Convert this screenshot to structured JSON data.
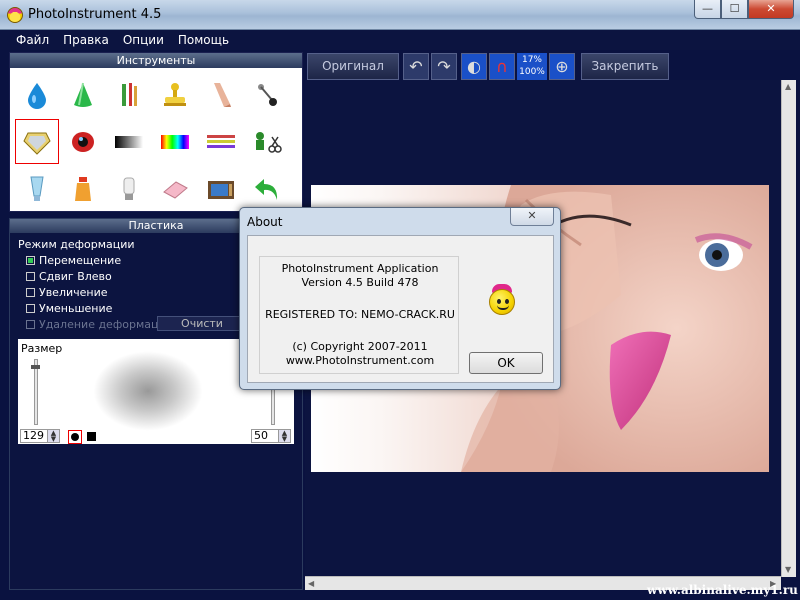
{
  "window": {
    "title": "PhotoInstrument 4.5",
    "min": "—",
    "max": "☐",
    "close": "✕"
  },
  "menu": [
    "Файл",
    "Правка",
    "Опции",
    "Помощь"
  ],
  "tools_panel": {
    "title": "Инструменты",
    "tools": [
      "drop-tool-icon",
      "cone-tool-icon",
      "pencil-brush-icon",
      "stamp-icon",
      "smudge-icon",
      "pin-icon",
      "diamond-icon",
      "red-eye-icon",
      "gradient-icon",
      "rainbow-palette-icon",
      "color-lines-icon",
      "cut-paste-icon",
      "tube-icon",
      "bottle-icon",
      "bulb-icon",
      "eraser-icon",
      "tv-icon",
      "undo-arrow-icon"
    ]
  },
  "plastic_panel": {
    "title": "Пластика",
    "mode_label": "Режим деформации",
    "options": [
      {
        "label": "Перемещение",
        "checked": true
      },
      {
        "label": "Сдвиг Влево",
        "checked": false
      },
      {
        "label": "Увеличение",
        "checked": false
      },
      {
        "label": "Уменьшение",
        "checked": false
      }
    ],
    "remove_label": "Удаление деформации",
    "clear_label": "Очисти",
    "size_label": "Размер",
    "close_mark": "X",
    "left_value": "129",
    "right_value": "50"
  },
  "toolbar": {
    "original_label": "Оригинал",
    "zoom_top": "17%",
    "zoom_bottom": "100%",
    "pin_label": "Закрепить"
  },
  "about": {
    "title": "About",
    "close": "✕",
    "lines": [
      "PhotoInstrument Application",
      "Version 4.5 Build 478",
      "",
      "REGISTERED TO: NEMO-CRACK.RU",
      "",
      "(c) Copyright 2007-2011",
      "www.PhotoInstrument.com"
    ],
    "ok_label": "OK"
  },
  "watermark": "www.albinalive.my1.ru"
}
